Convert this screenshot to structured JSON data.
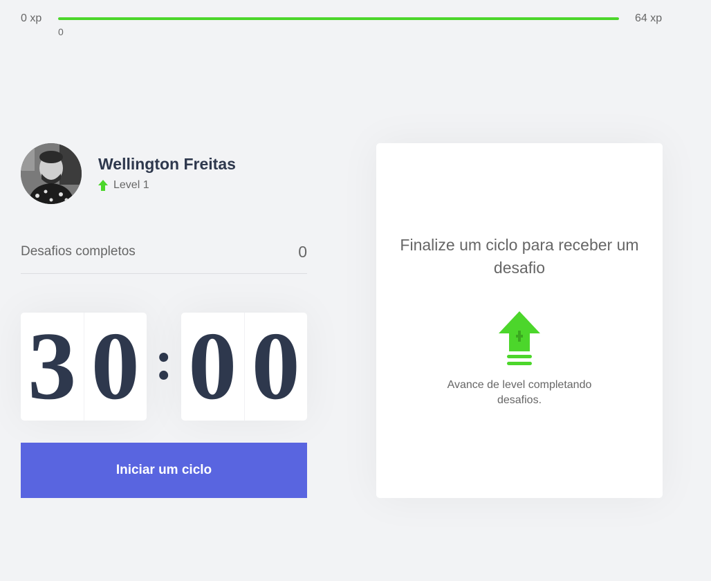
{
  "experience": {
    "min_label": "0 xp",
    "max_label": "64 xp",
    "current_label": "0",
    "progress_percent": 100,
    "bar_color": "#4cd62b"
  },
  "profile": {
    "name": "Wellington Freitas",
    "level_label": "Level 1",
    "level_icon": "level-up-arrow-icon"
  },
  "challenges": {
    "label": "Desafios completos",
    "count": "0"
  },
  "countdown": {
    "minute_left": "3",
    "minute_right": "0",
    "separator": ":",
    "second_left": "0",
    "second_right": "0"
  },
  "start_button": {
    "label": "Iniciar um ciclo",
    "color": "#5965e0"
  },
  "challenge_box": {
    "title": "Finalize um ciclo para receber um desafio",
    "description": "Avance de level completando desafios.",
    "icon": "level-up-icon"
  }
}
